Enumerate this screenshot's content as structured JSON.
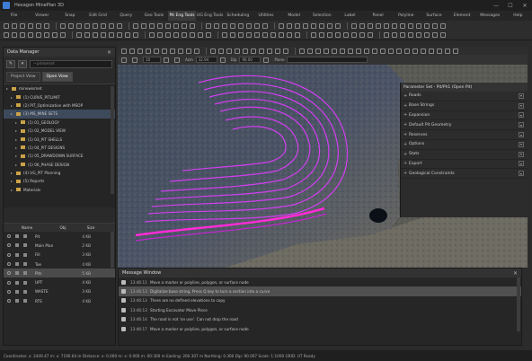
{
  "window": {
    "title": "Hexagon MinePlan 3D",
    "controls": [
      "—",
      "☐",
      "✕"
    ]
  },
  "menu": [
    {
      "label": "File",
      "active": false
    },
    {
      "label": "Viewer",
      "active": false
    },
    {
      "label": "Snap",
      "active": false
    },
    {
      "label": "Edit Grid",
      "active": false
    },
    {
      "label": "Query",
      "active": false
    },
    {
      "label": "Geo Tools",
      "active": false
    },
    {
      "label": "Pit Eng Tools",
      "active": true
    },
    {
      "label": "UG Eng Tools",
      "active": false
    },
    {
      "label": "Scheduling",
      "active": false
    },
    {
      "label": "Utilities",
      "active": false
    },
    {
      "label": "Model",
      "active": false
    },
    {
      "label": "Selection",
      "active": false
    },
    {
      "label": "Label",
      "active": false
    },
    {
      "label": "Panel",
      "active": false
    },
    {
      "label": "Polyline",
      "active": false
    },
    {
      "label": "Surface",
      "active": false
    },
    {
      "label": "Element",
      "active": false
    },
    {
      "label": "Messages",
      "active": false
    },
    {
      "label": "Help",
      "active": false
    }
  ],
  "data_manager": {
    "title": "Data Manager",
    "search_placeholder": "~pmwmet",
    "tabs": [
      {
        "label": "Project View",
        "active": false
      },
      {
        "label": "Open View",
        "active": true
      }
    ],
    "tree": [
      {
        "label": "minewismet",
        "indent": 0,
        "selected": false
      },
      {
        "label": "(1) CURVE_PITLIMIT",
        "indent": 1,
        "selected": false
      },
      {
        "label": "(2) PIT_Optimization with MSOP",
        "indent": 1,
        "selected": false
      },
      {
        "label": "(3) MS_MINE SETS",
        "indent": 1,
        "selected": true
      },
      {
        "label": "(1) 01_GEOLOGY",
        "indent": 2,
        "selected": false
      },
      {
        "label": "(1) 02_MODEL VIEW",
        "indent": 2,
        "selected": false
      },
      {
        "label": "(1) 03_PIT SHELLS",
        "indent": 2,
        "selected": false
      },
      {
        "label": "(1) 04_PIT DESIGNS",
        "indent": 2,
        "selected": false
      },
      {
        "label": "(1) 05_DRAWDOWN SURFACE",
        "indent": 2,
        "selected": false
      },
      {
        "label": "(1) 06_PHASE DESIGN",
        "indent": 2,
        "selected": false
      },
      {
        "label": "(4) UG_PIT Planning",
        "indent": 1,
        "selected": false
      },
      {
        "label": "(5) Reports",
        "indent": 1,
        "selected": false
      },
      {
        "label": "Materials",
        "indent": 1,
        "selected": false
      }
    ],
    "layer_columns": [
      "Name",
      "Obj",
      "Size"
    ],
    "layers": [
      {
        "name": "Pit",
        "obj": "",
        "size": "4 KB",
        "selected": false
      },
      {
        "name": "Main Plan",
        "obj": "",
        "size": "2 KB",
        "selected": false
      },
      {
        "name": "Fill",
        "obj": "",
        "size": "3 KB",
        "selected": false
      },
      {
        "name": "Toe",
        "obj": "",
        "size": "4 KB",
        "selected": false
      },
      {
        "name": "Pits",
        "obj": "",
        "size": "5 KB",
        "selected": true
      },
      {
        "name": "UPT",
        "obj": "",
        "size": "4 KB",
        "selected": false
      },
      {
        "name": "WASTE",
        "obj": "",
        "size": "3 KB",
        "selected": false
      },
      {
        "name": "RTS",
        "obj": "",
        "size": "4 KB",
        "selected": false
      }
    ]
  },
  "viewport_toolbar": {
    "fields": [
      {
        "label": "",
        "value": "10"
      },
      {
        "label": "Azm",
        "value": "32.94"
      },
      {
        "label": "Dip",
        "value": "90.00"
      },
      {
        "label": "Plane",
        "value": ""
      }
    ]
  },
  "right_dock": {
    "title": "Parameter Set - Pit/Ph1 (Open Pit)",
    "items": [
      "Roads",
      "Base Strings",
      "Expansion",
      "Default Pit Geometry",
      "Reserves",
      "Options",
      "Stats",
      "Export",
      "Geological Constraints"
    ]
  },
  "message_window": {
    "title": "Message Window",
    "messages": [
      {
        "time": "13:46:11",
        "text": "Move a marker or polyline, polygon, or surface node",
        "selected": false
      },
      {
        "time": "13:46:13",
        "text": "Digitalize base string. Press Q key to turn a section into a curve",
        "selected": true
      },
      {
        "time": "13:46:13",
        "text": "There are no defined elevations to copy",
        "selected": false
      },
      {
        "time": "13:46:13",
        "text": "Starting Excavator Move Piece",
        "selected": false
      },
      {
        "time": "13:46:14",
        "text": "The road is not 'on use'. Can not drop the road",
        "selected": false
      },
      {
        "time": "13:46:17",
        "text": "Move a marker or polyline, polygon, or surface node",
        "selected": false
      }
    ]
  },
  "status": {
    "text": "Coordinates: x: 2449.47  m: x: 7190.64 m    Distance: x: 0.000  m: x: 0.000  m: 00:300  m    Easting: 200.307 m   Northing: 0.300   Dip: 90.007   Scale: 1:1000   GRID: UT   Ready"
  },
  "colors": {
    "accent": "#3d7fd6",
    "contour": "#d23ef0",
    "road": "#ff2bd6"
  }
}
